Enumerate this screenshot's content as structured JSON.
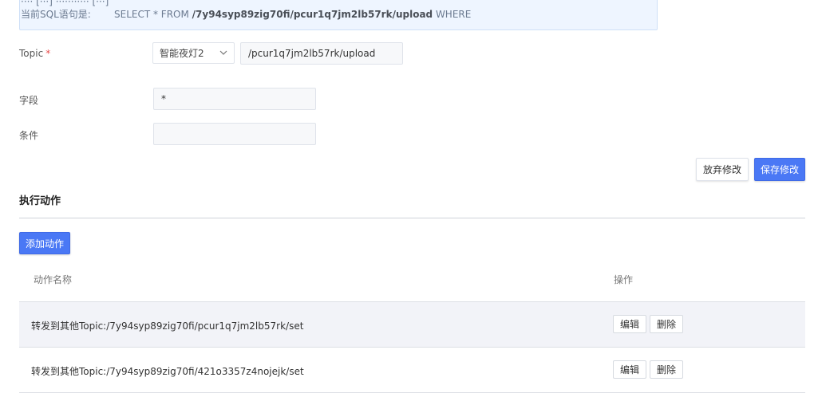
{
  "sql_info": {
    "partial_line": "···· [···] ··········· [···]",
    "label": "当前SQL语句是:",
    "statement_prefix": "SELECT * FROM ",
    "statement_path": "/7y94syp89zig70fi/pcur1q7jm2lb57rk/upload",
    "statement_suffix": " WHERE"
  },
  "form": {
    "topic_label": "Topic",
    "required_mark": "*",
    "device_select": "智能夜灯2",
    "topic_path": "/pcur1q7jm2lb57rk/upload",
    "field_label": "字段",
    "field_value": "*",
    "condition_label": "条件",
    "condition_value": ""
  },
  "buttons": {
    "discard": "放弃修改",
    "save": "保存修改",
    "add_action": "添加动作"
  },
  "actions_section": {
    "title": "执行动作",
    "columns": [
      "动作名称",
      "操作"
    ],
    "rows": [
      {
        "name": "转发到其他Topic:/7y94syp89zig70fi/pcur1q7jm2lb57rk/set",
        "edit": "编辑",
        "delete": "删除"
      },
      {
        "name": "转发到其他Topic:/7y94syp89zig70fi/421o3357z4nojejk/set",
        "edit": "编辑",
        "delete": "删除"
      }
    ]
  },
  "colors": {
    "primary": "#4a78f5",
    "info_bg": "#eef5ff",
    "required": "#e84a4a",
    "row_highlight": "#f2f3f8"
  },
  "icons": {
    "select_chevron": "chevron-down-icon"
  }
}
